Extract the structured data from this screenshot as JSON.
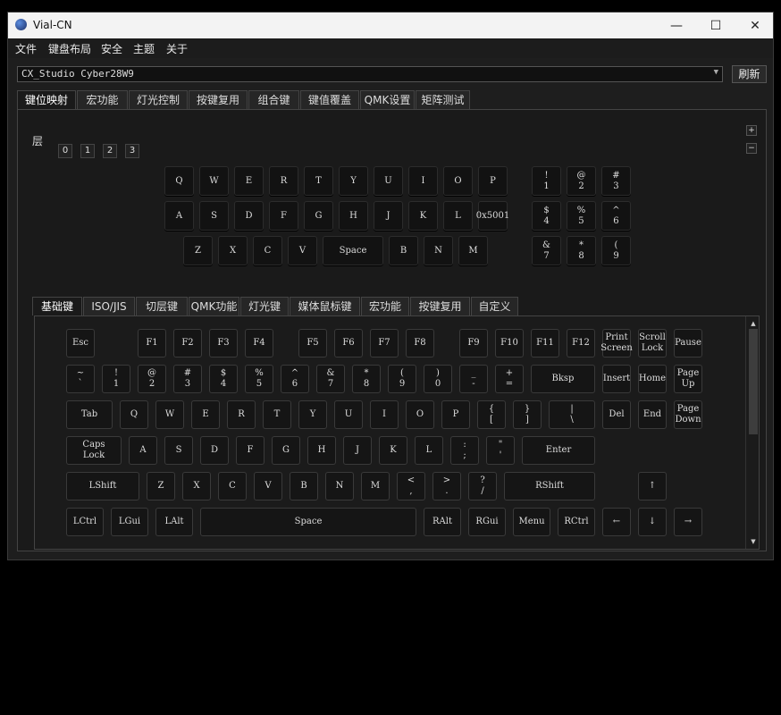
{
  "window": {
    "title": "Vial-CN",
    "minimize": "—",
    "maximize": "☐",
    "close": "✕"
  },
  "menu": [
    "文件",
    "键盘布局",
    "安全",
    "主题",
    "关于"
  ],
  "device": {
    "selected": "CX_Studio Cyber28W9",
    "refresh_label": "刷新"
  },
  "main_tabs": [
    "键位映射",
    "宏功能",
    "灯光控制",
    "按键复用",
    "组合键",
    "键值覆盖",
    "QMK设置",
    "矩阵测试"
  ],
  "layers": {
    "label": "层",
    "items": [
      "0",
      "1",
      "2",
      "3"
    ],
    "plus": "+",
    "minus": "−"
  },
  "keyboard_rows": [
    [
      "Q",
      "W",
      "E",
      "R",
      "T",
      "Y",
      "U",
      "I",
      "O",
      "P"
    ],
    [
      "A",
      "S",
      "D",
      "F",
      "G",
      "H",
      "J",
      "K",
      "L",
      "0x5001"
    ],
    [
      "Z",
      "X",
      "C",
      "V",
      "Space",
      "B",
      "N",
      "M"
    ]
  ],
  "numpad_rows": [
    [
      "!\n1",
      "@\n2",
      "#\n3"
    ],
    [
      "$\n4",
      "%\n5",
      "^\n6"
    ],
    [
      "&\n7",
      "*\n8",
      "(\n9"
    ]
  ],
  "keycode_tabs": [
    "基础键",
    "ISO/JIS",
    "切层键",
    "QMK功能",
    "灯光键",
    "媒体鼠标键",
    "宏功能",
    "按键复用",
    "自定义"
  ],
  "palette_rows": [
    [
      "Esc",
      "F1",
      "F2",
      "F3",
      "F4",
      "F5",
      "F6",
      "F7",
      "F8",
      "F9",
      "F10",
      "F11",
      "F12",
      "Print\nScreen",
      "Scroll\nLock",
      "Pause"
    ],
    [
      "~\n`",
      "!\n1",
      "@\n2",
      "#\n3",
      "$\n4",
      "%\n5",
      "^\n6",
      "&\n7",
      "*\n8",
      "(\n9",
      ")\n0",
      "_\n-",
      "+\n=",
      "Bksp",
      "Insert",
      "Home",
      "Page\nUp"
    ],
    [
      "Tab",
      "Q",
      "W",
      "E",
      "R",
      "T",
      "Y",
      "U",
      "I",
      "O",
      "P",
      "{\n[",
      "}\n]",
      "|\n\\",
      "Del",
      "End",
      "Page\nDown"
    ],
    [
      "Caps\nLock",
      "A",
      "S",
      "D",
      "F",
      "G",
      "H",
      "J",
      "K",
      "L",
      ":\n;",
      "\"\n'",
      "Enter"
    ],
    [
      "LShift",
      "Z",
      "X",
      "C",
      "V",
      "B",
      "N",
      "M",
      "<\n,",
      ">\n.",
      "?\n/",
      "RShift",
      "↑"
    ],
    [
      "LCtrl",
      "LGui",
      "LAlt",
      "Space",
      "RAlt",
      "RGui",
      "Menu",
      "RCtrl",
      "←",
      "↓",
      "→"
    ]
  ],
  "scroll": {
    "up": "▲",
    "down": "▼"
  }
}
